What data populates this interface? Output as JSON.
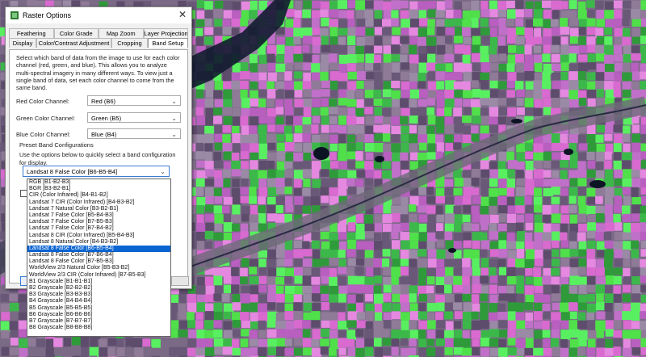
{
  "window": {
    "title": "Raster Options"
  },
  "tabs": {
    "row1": [
      "Feathering",
      "Color Grade",
      "Map Zoom",
      "Layer Projection"
    ],
    "row2": [
      "Display",
      "Color/Contrast Adjustment",
      "Cropping",
      "Band Setup"
    ]
  },
  "band_setup": {
    "description": "Select which band of data from the image to use for each color channel (red, green, and blue). This allows you to analyze multi-spectral imagery in many different ways. To view just a single band of data, set each color channel to come from the same band.",
    "red_label": "Red Color Channel:",
    "red_value": "Red (B6)",
    "green_label": "Green Color Channel:",
    "green_value": "Green (B5)",
    "blue_label": "Blue Color Channel:",
    "blue_value": "Blue (B4)",
    "preset_title": "Preset Band Configurations",
    "preset_text": "Use the options below to quickly select a band configuration for display.",
    "preset_value": "Landsat 8 False Color [B6-B5-B4]",
    "options": [
      "RGB [B1-B2-B3]",
      "BGR [B3-B2-B1]",
      "CIR (Color Infrared) [B4-B1-B2]",
      "Landsat 7 CIR (Color Infrared) [B4-B3-B2]",
      "Landsat 7 Natural Color [B3-B2-B1]",
      "Landsat 7 False Color [B5-B4-B3]",
      "Landsat 7 False Color [B7-B5-B3]",
      "Landsat 7 False Color [B7-B4-B2]",
      "Landsat 8 CIR (Color Infrared) [B5-B4-B3]",
      "Landsat 8 Natural Color [B4-B3-B2]",
      "Landsat 8 False Color [B6-B5-B4]",
      "Landsat 8 False Color [B7-B6-B4]",
      "Landsat 8 False Color [B7-B5-B3]",
      "WorldView 2/3 Natural Color [B5-B3-B2]",
      "WorldView 2/3 CIR (Color Infrared) [B7-B5-B3]",
      "B1 Grayscale [B1-B1-B1]",
      "B2 Grayscale [B2-B2-B2]",
      "B3 Grayscale [B3-B3-B3]",
      "B4 Grayscale [B4-B4-B4]",
      "B5 Grayscale [B5-B5-B5]",
      "B6 Grayscale [B6-B6-B6]",
      "B7 Grayscale [B7-B7-B7]",
      "B8 Grayscale [B8-B8-B8]"
    ],
    "selected_index": 10
  },
  "colors": {
    "selection": "#0a64d2",
    "field_pink": "#d86ad0",
    "field_green": "#4fe04a",
    "water": "#0e1a2e"
  }
}
